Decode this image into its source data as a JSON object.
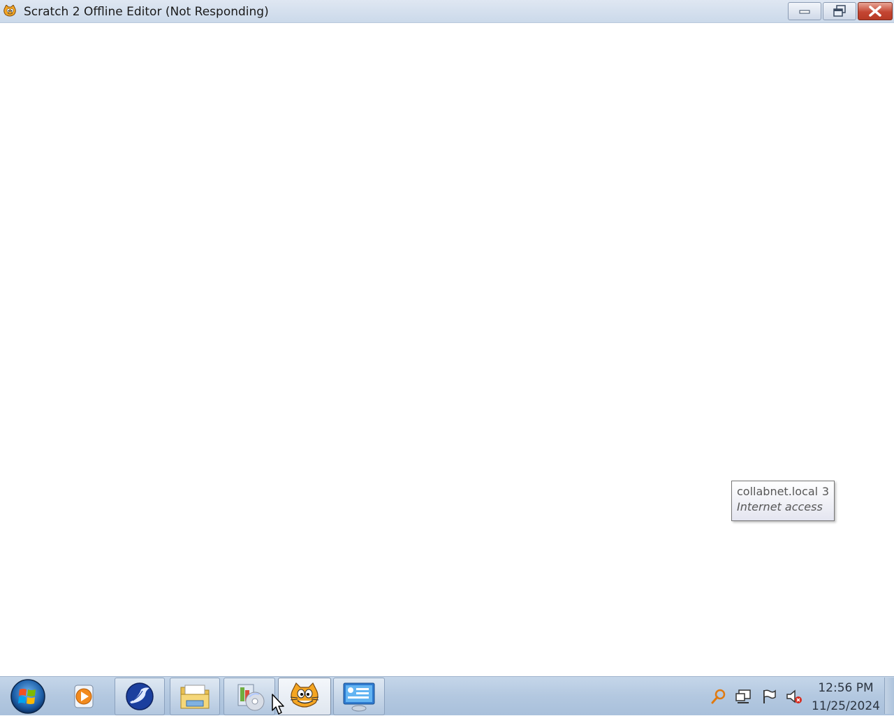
{
  "window": {
    "title": "Scratch 2 Offline Editor (Not Responding)",
    "icon": "scratch-cat-icon",
    "controls": [
      "minimize",
      "restore",
      "close"
    ]
  },
  "tooltip": {
    "network_name": "collabnet.local",
    "network_number": "3",
    "status": "Internet access"
  },
  "taskbar": {
    "pinned": [
      {
        "name": "windows-media-player-icon",
        "open": false
      },
      {
        "name": "seamonkey-icon",
        "open": true
      },
      {
        "name": "file-explorer-icon",
        "open": true
      },
      {
        "name": "disc-installer-icon",
        "open": true
      },
      {
        "name": "scratch-cat-icon",
        "open": true,
        "active": true
      },
      {
        "name": "remote-desktop-icon",
        "open": true
      }
    ],
    "tray": [
      "search-key-icon",
      "network-icon",
      "action-center-flag-icon",
      "volume-muted-icon"
    ],
    "clock": {
      "time": "12:56 PM",
      "date": "11/25/2024"
    }
  },
  "colors": {
    "close_button": "#c44633",
    "taskbar": "#b3c8e0",
    "titlebar": "#dfe7f2"
  }
}
